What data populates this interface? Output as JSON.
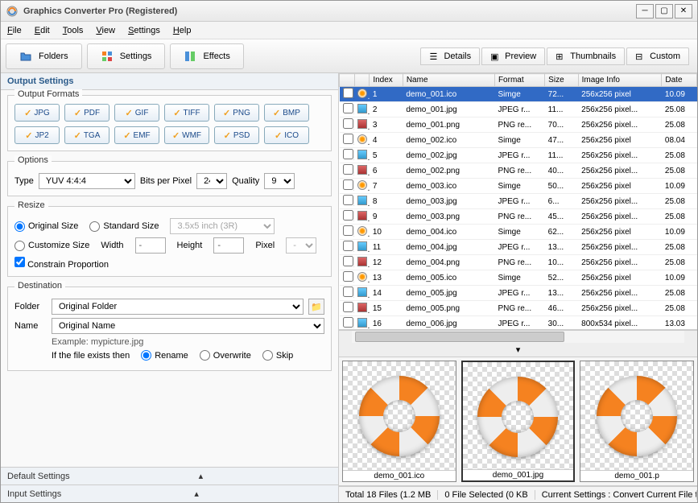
{
  "window": {
    "title": "Graphics Converter Pro  (Registered)"
  },
  "menu": {
    "file": "File",
    "edit": "Edit",
    "tools": "Tools",
    "view": "View",
    "settings": "Settings",
    "help": "Help"
  },
  "toolbar": {
    "folders": "Folders",
    "settings": "Settings",
    "effects": "Effects"
  },
  "viewTabs": {
    "details": "Details",
    "preview": "Preview",
    "thumbnails": "Thumbnails",
    "custom": "Custom"
  },
  "outputSettings": {
    "title": "Output Settings",
    "formatsTitle": "Output Formats",
    "formats": [
      "JPG",
      "PDF",
      "GIF",
      "TIFF",
      "PNG",
      "BMP",
      "JP2",
      "TGA",
      "EMF",
      "WMF",
      "PSD",
      "ICO"
    ],
    "optionsTitle": "Options",
    "typeLabel": "Type",
    "typeValue": "YUV 4:4:4",
    "bppLabel": "Bits per Pixel",
    "bppValue": "24",
    "qualityLabel": "Quality",
    "qualityValue": "9",
    "resizeTitle": "Resize",
    "originalSize": "Original Size",
    "standardSize": "Standard Size",
    "standardValue": "3.5x5 inch (3R)",
    "customizeSize": "Customize Size",
    "widthLabel": "Width",
    "widthValue": "-",
    "heightLabel": "Height",
    "heightValue": "-",
    "unitLabel": "Pixel",
    "unitValue": "-",
    "constrain": "Constrain Proportion",
    "destinationTitle": "Destination",
    "folderLabel": "Folder",
    "folderValue": "Original Folder",
    "nameLabel": "Name",
    "nameValue": "Original Name",
    "example": "Example: mypicture.jpg",
    "existsLabel": "If the file exists then",
    "rename": "Rename",
    "overwrite": "Overwrite",
    "skip": "Skip",
    "defaultSettings": "Default Settings",
    "inputSettings": "Input Settings"
  },
  "fileList": {
    "headers": {
      "index": "Index",
      "name": "Name",
      "format": "Format",
      "size": "Size",
      "imageInfo": "Image Info",
      "date": "Date"
    },
    "rows": [
      {
        "idx": 1,
        "name": "demo_001.ico",
        "fmt": "Simge",
        "size": "72...",
        "info": "256x256 pixel",
        "date": "10.09",
        "type": "ico",
        "sel": true
      },
      {
        "idx": 2,
        "name": "demo_001.jpg",
        "fmt": "JPEG r...",
        "size": "11...",
        "info": "256x256 pixel...",
        "date": "25.08",
        "type": "jpg"
      },
      {
        "idx": 3,
        "name": "demo_001.png",
        "fmt": "PNG re...",
        "size": "70...",
        "info": "256x256 pixel...",
        "date": "25.08",
        "type": "png"
      },
      {
        "idx": 4,
        "name": "demo_002.ico",
        "fmt": "Simge",
        "size": "47...",
        "info": "256x256 pixel",
        "date": "08.04",
        "type": "ico"
      },
      {
        "idx": 5,
        "name": "demo_002.jpg",
        "fmt": "JPEG r...",
        "size": "11...",
        "info": "256x256 pixel...",
        "date": "25.08",
        "type": "jpg"
      },
      {
        "idx": 6,
        "name": "demo_002.png",
        "fmt": "PNG re...",
        "size": "40...",
        "info": "256x256 pixel...",
        "date": "25.08",
        "type": "png"
      },
      {
        "idx": 7,
        "name": "demo_003.ico",
        "fmt": "Simge",
        "size": "50...",
        "info": "256x256 pixel",
        "date": "10.09",
        "type": "ico"
      },
      {
        "idx": 8,
        "name": "demo_003.jpg",
        "fmt": "JPEG r...",
        "size": "6...",
        "info": "256x256 pixel...",
        "date": "25.08",
        "type": "jpg"
      },
      {
        "idx": 9,
        "name": "demo_003.png",
        "fmt": "PNG re...",
        "size": "45...",
        "info": "256x256 pixel...",
        "date": "25.08",
        "type": "png"
      },
      {
        "idx": 10,
        "name": "demo_004.ico",
        "fmt": "Simge",
        "size": "62...",
        "info": "256x256 pixel",
        "date": "10.09",
        "type": "ico"
      },
      {
        "idx": 11,
        "name": "demo_004.jpg",
        "fmt": "JPEG r...",
        "size": "13...",
        "info": "256x256 pixel...",
        "date": "25.08",
        "type": "jpg"
      },
      {
        "idx": 12,
        "name": "demo_004.png",
        "fmt": "PNG re...",
        "size": "10...",
        "info": "256x256 pixel...",
        "date": "25.08",
        "type": "png"
      },
      {
        "idx": 13,
        "name": "demo_005.ico",
        "fmt": "Simge",
        "size": "52...",
        "info": "256x256 pixel",
        "date": "10.09",
        "type": "ico"
      },
      {
        "idx": 14,
        "name": "demo_005.jpg",
        "fmt": "JPEG r...",
        "size": "13...",
        "info": "256x256 pixel...",
        "date": "25.08",
        "type": "jpg"
      },
      {
        "idx": 15,
        "name": "demo_005.png",
        "fmt": "PNG re...",
        "size": "46...",
        "info": "256x256 pixel...",
        "date": "25.08",
        "type": "png"
      },
      {
        "idx": 16,
        "name": "demo_006.jpg",
        "fmt": "JPEG r...",
        "size": "30...",
        "info": "800x534 pixel...",
        "date": "13.03",
        "type": "jpg"
      }
    ]
  },
  "previews": [
    {
      "name": "demo_001.ico"
    },
    {
      "name": "demo_001.jpg",
      "sel": true
    },
    {
      "name": "demo_001.p"
    }
  ],
  "status": {
    "total": "Total 18 Files (1.2 MB",
    "selected": "0 File Selected (0 KB",
    "current": "Current Settings : Convert Current File to JPG"
  }
}
